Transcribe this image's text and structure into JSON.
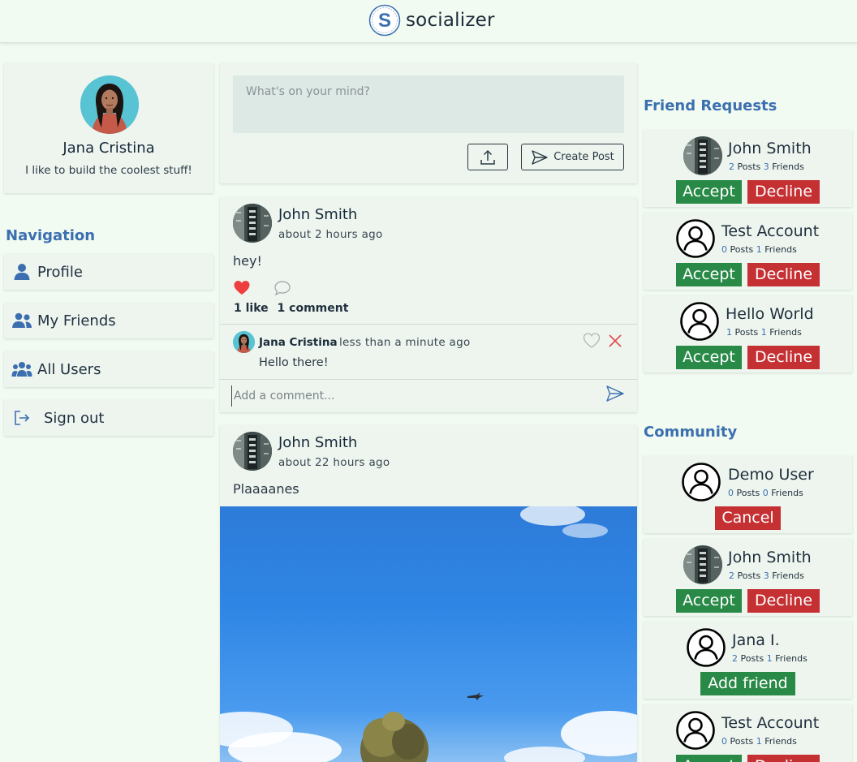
{
  "header": {
    "app_name": "socializer",
    "logo_letter": "S"
  },
  "profile": {
    "name": "Jana Cristina",
    "bio": "I like to build the coolest stuff!"
  },
  "navigation": {
    "title": "Navigation",
    "items": [
      {
        "label": "Profile",
        "icon": "person-icon"
      },
      {
        "label": "My Friends",
        "icon": "friends-icon"
      },
      {
        "label": "All Users",
        "icon": "users-icon"
      },
      {
        "label": "Sign out",
        "icon": "sign-out-icon"
      }
    ]
  },
  "composer": {
    "placeholder": "What's on your mind?",
    "upload_icon": "upload-icon",
    "create_label": "Create Post"
  },
  "posts": [
    {
      "author": "John Smith",
      "time": "about 2 hours ago",
      "text": "hey!",
      "liked": true,
      "likes": "1 like",
      "comments": "1 comment",
      "comment": {
        "author": "Jana Cristina",
        "time": "less than a minute ago",
        "text": "Hello there!"
      },
      "comment_placeholder": "Add a comment..."
    },
    {
      "author": "John Smith",
      "time": "about 22 hours ago",
      "text": "Plaaaanes"
    }
  ],
  "friend_requests": {
    "title": "Friend Requests",
    "users": [
      {
        "name": "John Smith",
        "posts": "2",
        "friends": "3",
        "posts_label": "Posts",
        "friends_label": "Friends",
        "accept": "Accept",
        "decline": "Decline"
      },
      {
        "name": "Test Account",
        "posts": "0",
        "friends": "1",
        "posts_label": "Posts",
        "friends_label": "Friends",
        "accept": "Accept",
        "decline": "Decline"
      },
      {
        "name": "Hello World",
        "posts": "1",
        "friends": "1",
        "posts_label": "Posts",
        "friends_label": "Friends",
        "accept": "Accept",
        "decline": "Decline"
      }
    ]
  },
  "community": {
    "title": "Community",
    "users": [
      {
        "name": "Demo User",
        "posts": "0",
        "friends": "0",
        "posts_label": "Posts",
        "friends_label": "Friends",
        "cancel": "Cancel"
      },
      {
        "name": "John Smith",
        "posts": "2",
        "friends": "3",
        "posts_label": "Posts",
        "friends_label": "Friends",
        "accept": "Accept",
        "decline": "Decline"
      },
      {
        "name": "Jana I.",
        "posts": "2",
        "friends": "1",
        "posts_label": "Posts",
        "friends_label": "Friends",
        "add": "Add friend"
      },
      {
        "name": "Test Account",
        "posts": "0",
        "friends": "1",
        "posts_label": "Posts",
        "friends_label": "Friends",
        "accept": "Accept",
        "decline": "Decline"
      }
    ]
  },
  "colors": {
    "background": "#f1fbf1",
    "card": "#eef5ee",
    "accent": "#3c6fb0",
    "accept": "#288a46",
    "decline": "#c53033"
  }
}
